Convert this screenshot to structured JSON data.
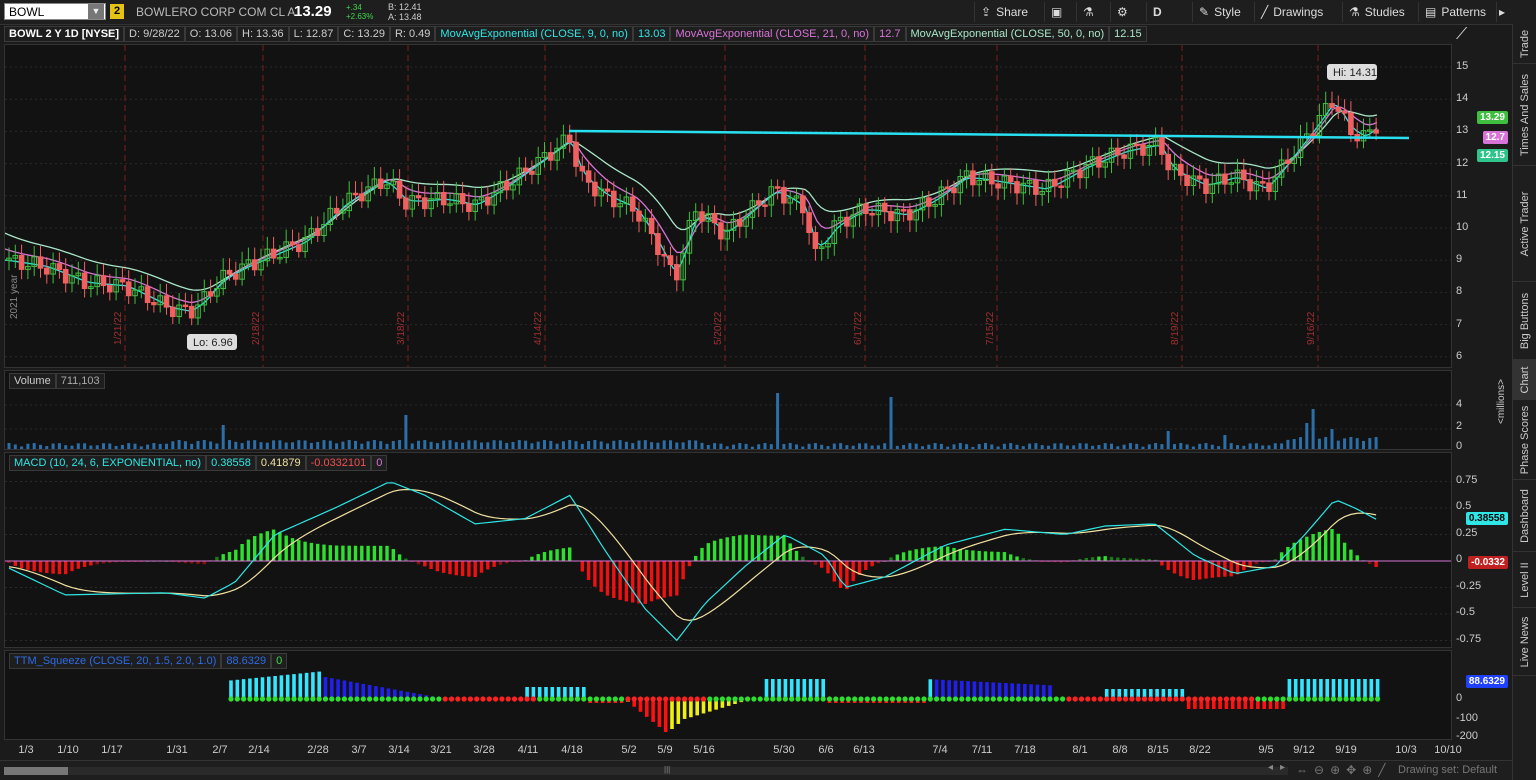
{
  "header": {
    "symbol": "BOWL",
    "link_badge": "2",
    "company": "BOWLERO CORP COM CL A",
    "last": "13.29",
    "change": "+.34",
    "change_pct": "+2.63%",
    "bid": "B: 12.41",
    "ask": "A: 13.48"
  },
  "toolbar": {
    "share": "Share",
    "aggregation": "D",
    "style": "Style",
    "drawings": "Drawings",
    "studies": "Studies",
    "patterns": "Patterns"
  },
  "study_line": {
    "title": "BOWL 2 Y 1D [NYSE]",
    "date": "D: 9/28/22",
    "open": "O: 13.06",
    "high": "H: 13.36",
    "low": "L: 12.87",
    "close": "C: 13.29",
    "range": "R: 0.49",
    "ema9_label": "MovAvgExponential (CLOSE, 9, 0, no)",
    "ema9_value": "13.03",
    "ema21_label": "MovAvgExponential (CLOSE, 21, 0, no)",
    "ema21_value": "12.7",
    "ema50_label": "MovAvgExponential (CLOSE, 50, 0, no)",
    "ema50_value": "12.15"
  },
  "price_panel": {
    "y_ticks": [
      "15",
      "14",
      "13",
      "12",
      "11",
      "10",
      "9",
      "8",
      "7",
      "6"
    ],
    "hi_label": "Hi: 14.31",
    "lo_label": "Lo: 6.96",
    "last_tag": "13.29",
    "ema21_tag": "12.7",
    "ema50_tag": "12.15",
    "year_label": "2021 year",
    "expiry_labels": [
      "1/21/22",
      "2/18/22",
      "3/18/22",
      "4/14/22",
      "5/20/22",
      "6/17/22",
      "7/15/22",
      "8/19/22",
      "9/16/22"
    ],
    "colors": {
      "up": "#3fbf3f",
      "down": "#f06060",
      "ema9": "#2ee6e6",
      "ema21": "#d873d8",
      "ema50": "#a8e6c8",
      "trendline": "#29e0f0"
    }
  },
  "volume_panel": {
    "label": "Volume",
    "value": "711,103",
    "y_ticks": [
      "4",
      "2",
      "0"
    ],
    "unit_label": "<millions>"
  },
  "macd_panel": {
    "label": "MACD (10, 24, 6, EXPONENTIAL, no)",
    "value": "0.38558",
    "avg": "0.41879",
    "diff": "-0.0332101",
    "zero": "0",
    "y_ticks": [
      "0.75",
      "0.5",
      "0.25",
      "0",
      "-0.25",
      "-0.5",
      "-0.75"
    ],
    "value_tag": "0.38558",
    "diff_tag": "-0.0332"
  },
  "squeeze_panel": {
    "label": "TTM_Squeeze (CLOSE, 20, 1.5, 2.0, 1.0)",
    "value": "88.6329",
    "zero": "0",
    "y_ticks": [
      "0",
      "-100",
      "-200"
    ],
    "value_tag": "88.6329"
  },
  "x_axis": {
    "ticks": [
      "1/3",
      "1/10",
      "1/17",
      "1/31",
      "2/7",
      "2/14",
      "2/28",
      "3/7",
      "3/14",
      "3/21",
      "3/28",
      "4/11",
      "4/18",
      "5/2",
      "5/9",
      "5/16",
      "5/30",
      "6/6",
      "6/13",
      "7/4",
      "7/11",
      "7/18",
      "8/1",
      "8/8",
      "8/15",
      "8/22",
      "9/5",
      "9/12",
      "9/19",
      "10/3",
      "10/10"
    ]
  },
  "sidebar": {
    "tabs": [
      "Trade",
      "Times And Sales",
      "Active Trader",
      "Big Buttons",
      "Chart",
      "Phase Scores",
      "Dashboard",
      "Level II",
      "Live News"
    ]
  },
  "footer": {
    "drawing_set": "Drawing set: Default"
  }
}
